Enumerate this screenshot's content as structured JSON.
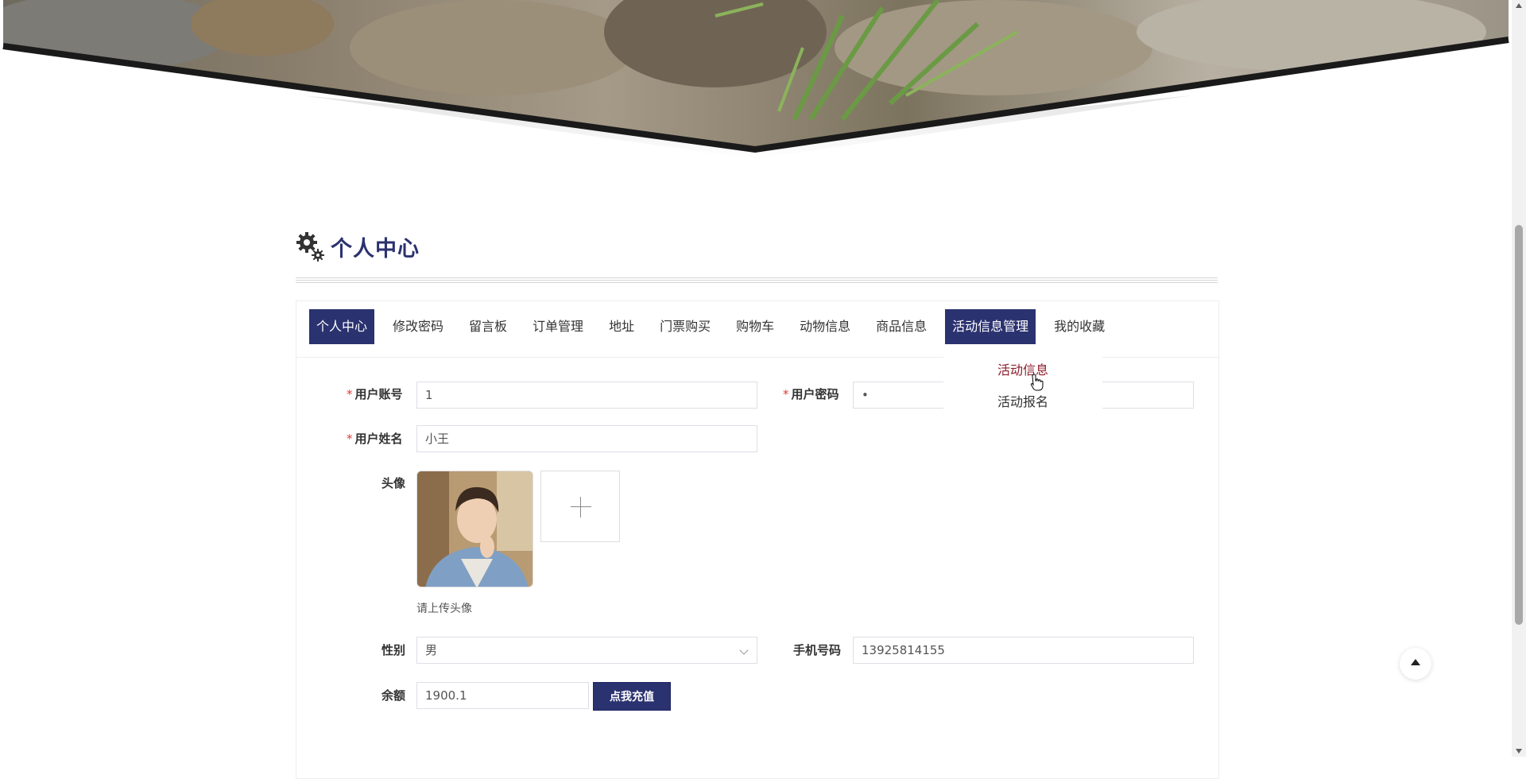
{
  "page": {
    "title": "个人中心",
    "icon": "gears-icon"
  },
  "tabs": [
    {
      "label": "个人中心",
      "active": true
    },
    {
      "label": "修改密码",
      "active": false
    },
    {
      "label": "留言板",
      "active": false
    },
    {
      "label": "订单管理",
      "active": false
    },
    {
      "label": "地址",
      "active": false
    },
    {
      "label": "门票购买",
      "active": false
    },
    {
      "label": "购物车",
      "active": false
    },
    {
      "label": "动物信息",
      "active": false
    },
    {
      "label": "商品信息",
      "active": false
    },
    {
      "label": "活动信息管理",
      "active": false
    },
    {
      "label": "我的收藏",
      "active": false
    }
  ],
  "dropdown": {
    "items": [
      {
        "label": "活动信息",
        "hovered": true
      },
      {
        "label": "活动报名",
        "hovered": false
      }
    ]
  },
  "form": {
    "account": {
      "label": "用户账号",
      "required": "*",
      "value": "1"
    },
    "password": {
      "label": "用户密码",
      "required": "*",
      "value": "•"
    },
    "name": {
      "label": "用户姓名",
      "required": "*",
      "value": "小王"
    },
    "avatar": {
      "label": "头像",
      "hint": "请上传头像"
    },
    "gender": {
      "label": "性别",
      "value": "男"
    },
    "phone": {
      "label": "手机号码",
      "value": "13925814155"
    },
    "balance": {
      "label": "余额",
      "value": "1900.1",
      "button": "点我充值"
    }
  },
  "colors": {
    "primary": "#2b3270",
    "required": "#e53935",
    "dropdown_hover": "#8b1c2b"
  }
}
